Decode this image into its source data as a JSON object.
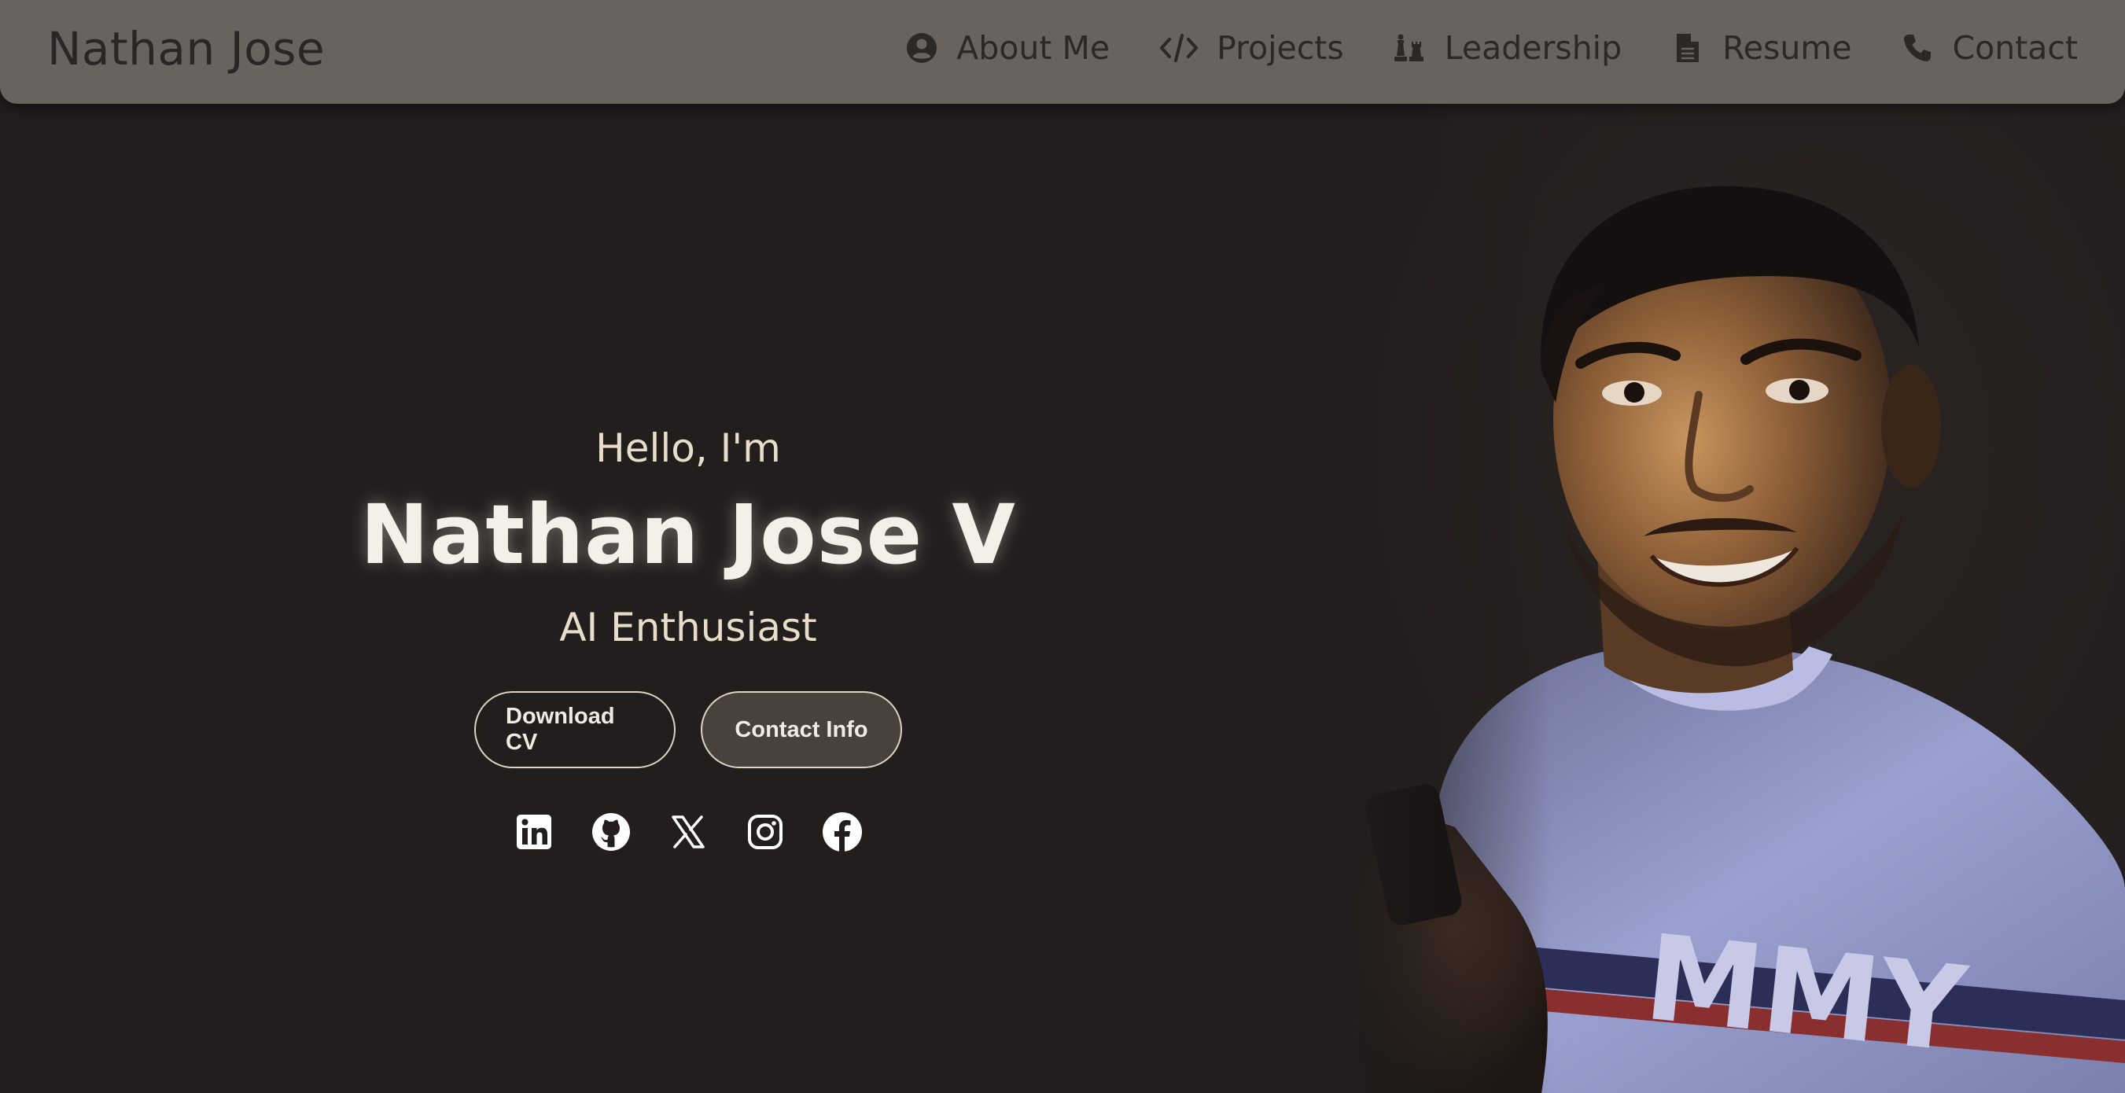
{
  "navbar": {
    "brand": "Nathan Jose",
    "items": [
      {
        "label": "About Me",
        "icon": "user-circle-icon"
      },
      {
        "label": "Projects",
        "icon": "code-icon"
      },
      {
        "label": "Leadership",
        "icon": "chess-icon"
      },
      {
        "label": "Resume",
        "icon": "document-icon"
      },
      {
        "label": "Contact",
        "icon": "phone-icon"
      }
    ]
  },
  "hero": {
    "greeting": "Hello, I'm",
    "name": "Nathan Jose V",
    "role": "AI Enthusiast",
    "buttons": {
      "download": "Download CV",
      "contact": "Contact Info"
    },
    "socials": [
      {
        "icon": "linkedin-icon"
      },
      {
        "icon": "github-icon"
      },
      {
        "icon": "x-twitter-icon"
      },
      {
        "icon": "instagram-icon"
      },
      {
        "icon": "facebook-icon"
      }
    ]
  },
  "colors": {
    "background": "#221e1d",
    "navbar": "#69635f",
    "nav_text": "#2c2826",
    "hero_text": "#f4efe9",
    "accent_text": "#e8dccb",
    "button_fill": "#4a413a"
  }
}
